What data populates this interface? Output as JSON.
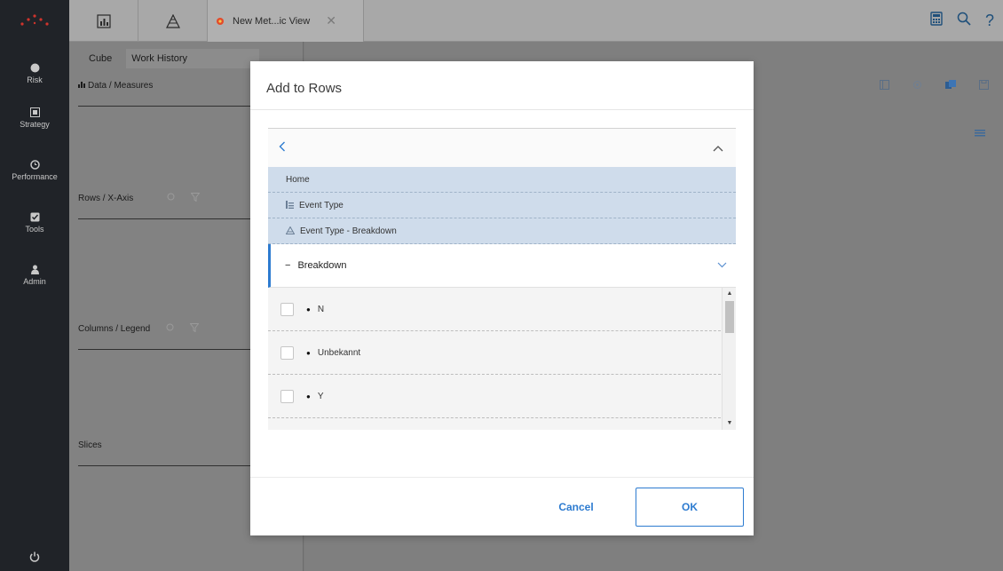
{
  "nav": {
    "items": [
      {
        "label": "Risk",
        "icon": "risk-icon"
      },
      {
        "label": "Strategy",
        "icon": "strategy-icon"
      },
      {
        "label": "Performance",
        "icon": "performance-icon"
      },
      {
        "label": "Tools",
        "icon": "tools-icon"
      },
      {
        "label": "Admin",
        "icon": "admin-icon"
      }
    ],
    "power_icon": "power-icon"
  },
  "topbar": {
    "tab_label": "New Met...ic View",
    "close_glyph": "✕",
    "right_icons": [
      "calculator-icon",
      "search-icon",
      "help-icon"
    ],
    "help_glyph": "?"
  },
  "sidepanel": {
    "cube_label": "Cube",
    "cube_value": "Work History",
    "sections": [
      {
        "label": "Data / Measures"
      },
      {
        "label": "Rows / X-Axis"
      },
      {
        "label": "Columns / Legend"
      },
      {
        "label": "Slices"
      }
    ]
  },
  "modal": {
    "title": "Add to Rows",
    "back_glyph": "<",
    "up_glyph": "^",
    "breadcrumbs": [
      {
        "label": "Home",
        "icon": ""
      },
      {
        "label": "Event Type",
        "icon": "hierarchy-icon"
      },
      {
        "label": "Event Type - Breakdown",
        "icon": "level-icon"
      }
    ],
    "current_level": {
      "label": "Breakdown",
      "dash": "−",
      "chevron": "﹀"
    },
    "items": [
      {
        "label": "N",
        "checked": false
      },
      {
        "label": "Unbekannt",
        "checked": false
      },
      {
        "label": "Y",
        "checked": false
      }
    ],
    "bullet_glyph": "●",
    "cancel_label": "Cancel",
    "ok_label": "OK"
  },
  "colors": {
    "accent": "#2d7bd0",
    "nav_bg": "#202328",
    "crumb_bg": "#cfdceb"
  }
}
